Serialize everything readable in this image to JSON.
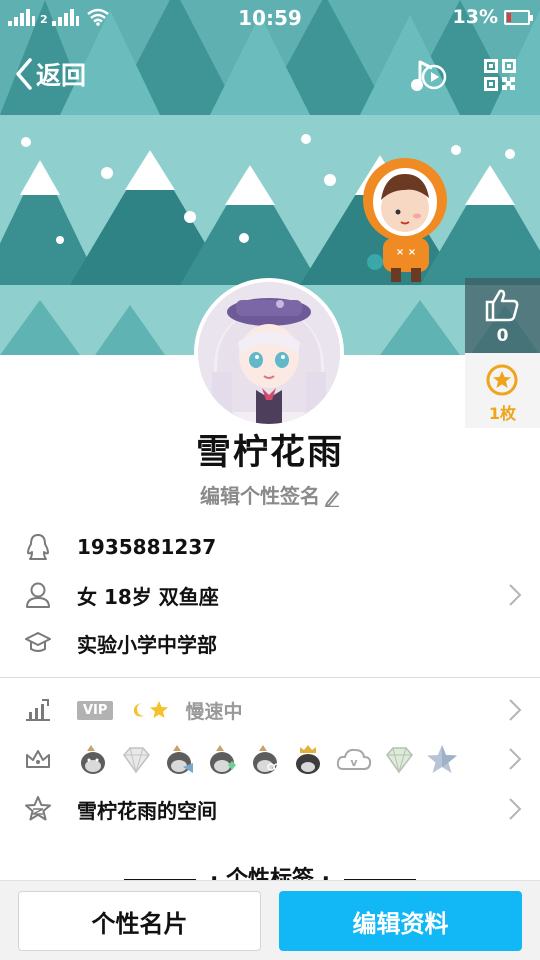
{
  "status_bar": {
    "time": "10:59",
    "battery": "13%",
    "sim_label": "2"
  },
  "nav": {
    "back_label": "返回",
    "music_icon": "music-note-icon",
    "qr_icon": "qr-code-icon"
  },
  "profile": {
    "like_count": "0",
    "medal_count": "1枚",
    "nickname": "雪柠花雨",
    "signature": "编辑个性签名"
  },
  "info": {
    "qq_number": "1935881237",
    "personal": "女  18岁  双鱼座",
    "school": "实验小学中学部"
  },
  "level": {
    "vip_badge": "VIP",
    "speed_text": "慢速中"
  },
  "space": {
    "label": "雪柠花雨的空间"
  },
  "tags": {
    "title": "· 个性标签 ·"
  },
  "bottom": {
    "card_button": "个性名片",
    "edit_button": "编辑资料"
  },
  "colors": {
    "banner_sky": "#8fd0cf",
    "tree_dark": "#3a8f90",
    "tree_mid": "#5fb3b3",
    "accent_blue": "#12b7f5",
    "medal_gold": "#f0a41c"
  }
}
